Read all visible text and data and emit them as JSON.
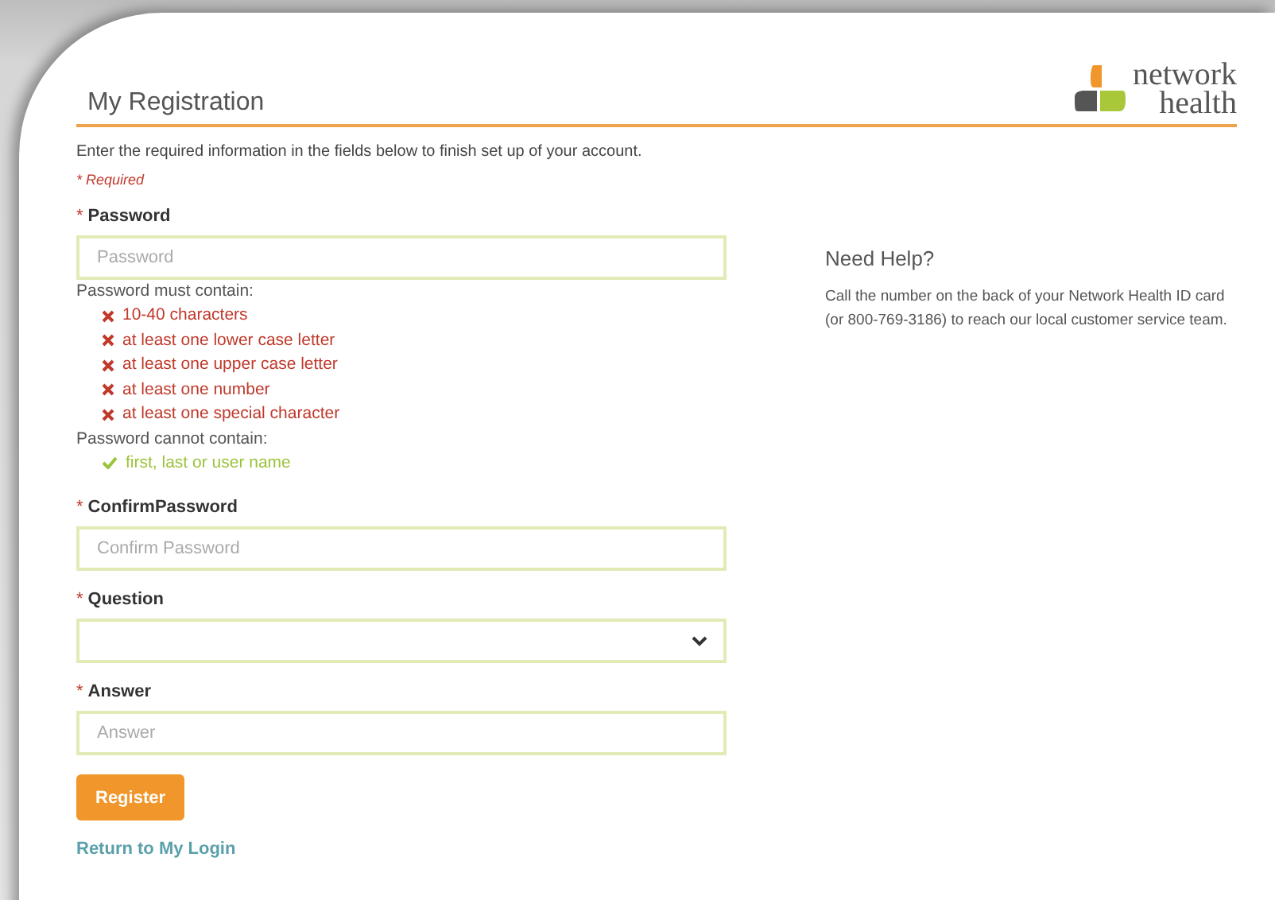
{
  "header": {
    "title": "My Registration",
    "logo": {
      "line1": "network",
      "line2": "health"
    }
  },
  "intro": "Enter the required information in the fields below to finish set up of your account.",
  "required_note": "* Required",
  "password": {
    "marker": "*",
    "label": "Password",
    "placeholder": "Password"
  },
  "must_contain": {
    "title": "Password must contain:",
    "rules": [
      {
        "text": "10-40 characters",
        "met": false
      },
      {
        "text": "at least one lower case letter",
        "met": false
      },
      {
        "text": "at least one upper case letter",
        "met": false
      },
      {
        "text": "at least one number",
        "met": false
      },
      {
        "text": "at least one special character",
        "met": false
      }
    ]
  },
  "cannot_contain": {
    "title": "Password cannot contain:",
    "rules": [
      {
        "text": "first, last or user name",
        "met": true
      }
    ]
  },
  "fields": [
    {
      "kind": "text",
      "marker": "*",
      "label": "ConfirmPassword",
      "placeholder": "Confirm Password"
    },
    {
      "kind": "select",
      "marker": "*",
      "label": "Question"
    },
    {
      "kind": "text",
      "marker": "*",
      "label": "Answer",
      "placeholder": "Answer"
    }
  ],
  "register_button": "Register",
  "login_link": "Return to My Login",
  "help": {
    "title": "Need Help?",
    "text": "Call the number on the back of your Network Health ID card (or 800-769-3186) to reach our local customer service team."
  }
}
